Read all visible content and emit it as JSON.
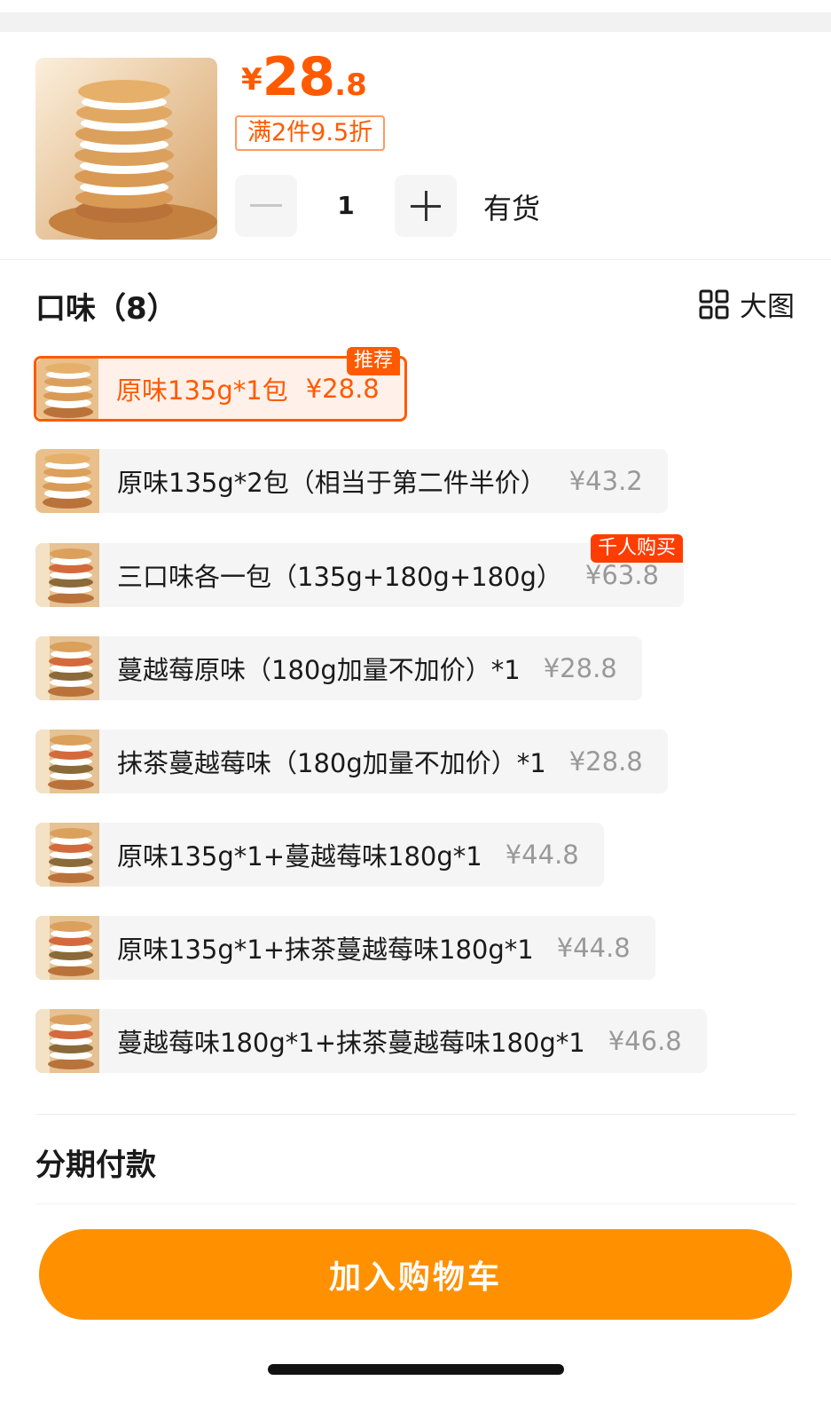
{
  "header": {
    "price_currency": "¥",
    "price_int": "28",
    "price_dec": ".8",
    "promo": "满2件9.5折",
    "quantity": "1",
    "stock": "有货"
  },
  "options_section": {
    "title": "口味（8）",
    "big_view_label": "大图"
  },
  "options": [
    {
      "label": "原味135g*1包",
      "price": "¥28.8",
      "selected": true,
      "tag": "推荐"
    },
    {
      "label": "原味135g*2包（相当于第二件半价）",
      "price": "¥43.2"
    },
    {
      "label": "三口味各一包（135g+180g+180g）",
      "price": "¥63.8",
      "tag": "千人购买"
    },
    {
      "label": "蔓越莓原味（180g加量不加价）*1",
      "price": "¥28.8"
    },
    {
      "label": "抹茶蔓越莓味（180g加量不加价）*1",
      "price": "¥28.8"
    },
    {
      "label": "原味135g*1+蔓越莓味180g*1",
      "price": "¥44.8"
    },
    {
      "label": "原味135g*1+抹茶蔓越莓味180g*1",
      "price": "¥44.8"
    },
    {
      "label": "蔓越莓味180g*1+抹茶蔓越莓味180g*1",
      "price": "¥46.8"
    }
  ],
  "installment": {
    "title": "分期付款"
  },
  "footer": {
    "add_to_cart": "加入购物车"
  },
  "colors": {
    "accent": "#ff5a00",
    "cta": "#ff9000"
  }
}
